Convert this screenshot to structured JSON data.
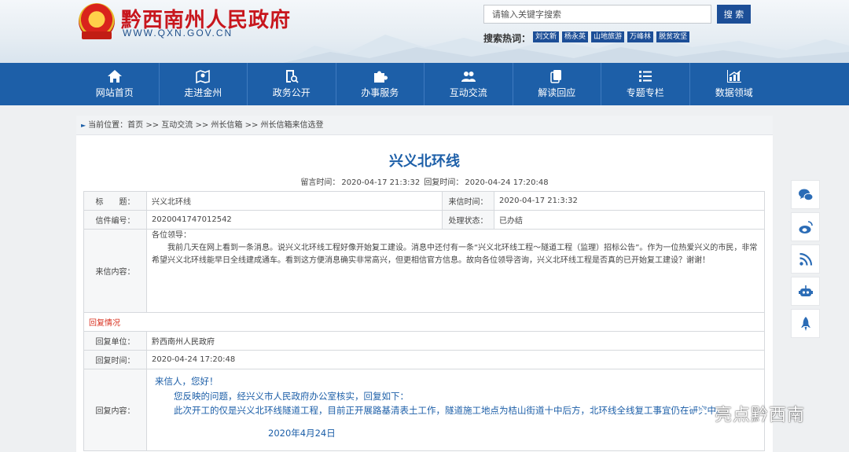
{
  "header": {
    "site_title": "黔西南州人民政府",
    "site_url": "WWW.QXN.GOV.CN",
    "search_placeholder": "请输入关键字搜索",
    "search_button": "搜 索",
    "hot_label": "搜索热词：",
    "hot_tags": [
      "刘文新",
      "杨永英",
      "山地旅游",
      "万峰林",
      "脱贫攻坚"
    ]
  },
  "nav": {
    "items": [
      {
        "label": "网站首页",
        "icon": "home-icon"
      },
      {
        "label": "走进金州",
        "icon": "map-pin-icon"
      },
      {
        "label": "政务公开",
        "icon": "document-search-icon"
      },
      {
        "label": "办事服务",
        "icon": "puzzle-icon"
      },
      {
        "label": "互动交流",
        "icon": "people-icon"
      },
      {
        "label": "解读回应",
        "icon": "copy-icon"
      },
      {
        "label": "专题专栏",
        "icon": "list-icon"
      },
      {
        "label": "数据领域",
        "icon": "chart-icon"
      }
    ]
  },
  "breadcrumb": {
    "prefix": "当前位置：",
    "items": [
      "首页",
      "互动交流",
      "州长信箱",
      "州长信箱来信选登"
    ],
    "sep": " >> "
  },
  "article": {
    "title": "兴义北环线",
    "meta_leave_label": "留言时间：",
    "meta_leave_time": "2020-04-17 21:3:32",
    "meta_reply_label": "回复时间：",
    "meta_reply_time": "2020-04-24 17:20:48"
  },
  "letter": {
    "subject_label": "标　　题：",
    "subject": "兴义北环线",
    "received_label": "来信时间：",
    "received": "2020-04-17 21:3:32",
    "number_label": "信件编号：",
    "number": "2020041747012542",
    "status_label": "处理状态：",
    "status": "已办结",
    "content_label": "来信内容：",
    "greeting": "各位领导：",
    "body": "　　我前几天在网上看到一条消息。说兴义北环线工程好像开始复工建设。消息中还付有一条“兴义北环线工程～隧道工程（监理）招标公告”。作为一位热爱兴义的市民，非常希望兴义北环线能早日全线建成通车。看到这方便消息确实非常高兴，但更相信官方信息。故向各位领导咨询，兴义北环线工程是否真的已开始复工建设？谢谢！"
  },
  "reply": {
    "section_label": "回复情况",
    "unit_label": "回复单位：",
    "unit": "黔西南州人民政府",
    "time_label": "回复时间：",
    "time": "2020-04-24 17:20:48",
    "content_label": "回复内容：",
    "line1": "来信人，您好！",
    "line2": "您反映的问题，经兴义市人民政府办公室核实，回复如下：",
    "line3": "此次开工的仅是兴义北环线隧道工程，目前正开展路基清表土工作，隧道施工地点为桔山街道十中后方，北环线全线复工事宜仍在研究中。",
    "date": "2020年4月24日"
  },
  "side_icons": [
    "wechat-icon",
    "weibo-icon",
    "rss-icon",
    "robot-icon",
    "rocket-icon"
  ],
  "watermark": {
    "text": "亮点黔西南"
  },
  "colors": {
    "nav_bg": "#1d5fa8",
    "title_blue": "#1d5fa8",
    "site_red": "#c8161d",
    "reply_red": "#d8301f"
  }
}
